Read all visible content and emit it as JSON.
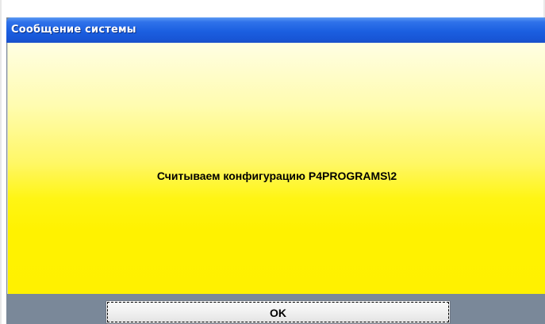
{
  "dialog": {
    "title": "Сообщение системы",
    "message": "Считываем конфигурацию P4PROGRAMS\\2",
    "ok_label": "OK"
  },
  "colors": {
    "titlebar": "#1b5fe0",
    "content_top": "#fffee3",
    "content_bottom": "#fff100",
    "footer": "#7a8899",
    "button": "#f2f2f2"
  }
}
